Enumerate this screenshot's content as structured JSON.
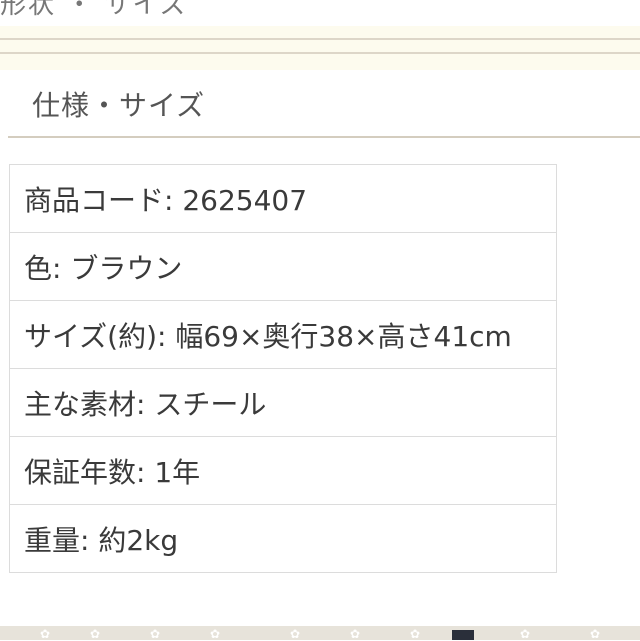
{
  "header": {
    "cut_text": "形状 ・ サイズ"
  },
  "section": {
    "title": "仕様・サイズ"
  },
  "specs": [
    {
      "text": "商品コード: 2625407"
    },
    {
      "text": "色: ブラウン"
    },
    {
      "text": "サイズ(約): 幅69×奥行38×高さ41cm"
    },
    {
      "text": "主な素材: スチール"
    },
    {
      "text": "保証年数: 1年"
    },
    {
      "text": "重量: 約2kg"
    }
  ],
  "colors": {
    "band": "#fdfbee",
    "rule": "#d4cdbf",
    "border": "#dcdcdc",
    "footer": "#e7e3da"
  },
  "icons": {
    "footer_pattern": "flower-icon"
  }
}
